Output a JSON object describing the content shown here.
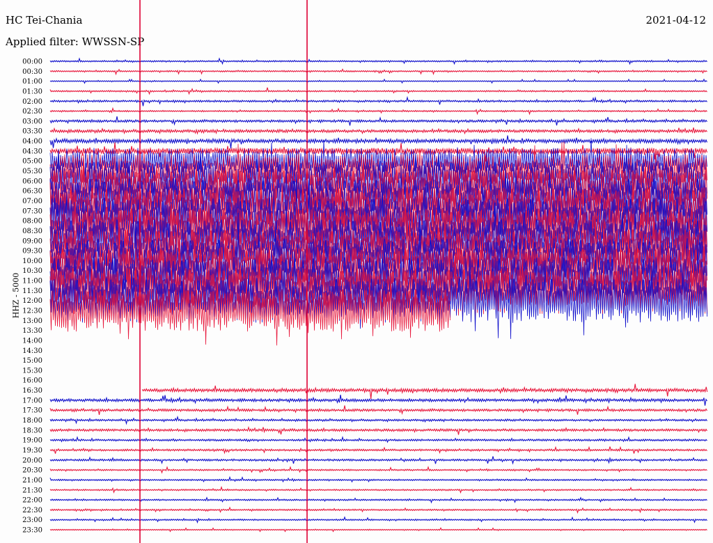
{
  "header": {
    "station": "HC Tei-Chania",
    "date": "2021-04-12",
    "filter": "Applied filter: WWSSN-SP"
  },
  "colors": {
    "trace_a": "#1010cc",
    "trace_b": "#e8183c",
    "marker": "#dd0033",
    "background": "#fdfdfd"
  },
  "chart_data": {
    "type": "line",
    "title": "HC Tei-Chania",
    "ylabel": "HHZ - 5000",
    "xlabel": "",
    "grid": false,
    "tick_labels": [
      "00:00",
      "00:30",
      "01:00",
      "01:30",
      "02:00",
      "02:30",
      "03:00",
      "03:30",
      "04:00",
      "04:30",
      "05:00",
      "05:30",
      "06:00",
      "06:30",
      "07:00",
      "07:30",
      "08:00",
      "08:30",
      "09:00",
      "09:30",
      "10:00",
      "10:30",
      "11:00",
      "11:30",
      "12:00",
      "12:30",
      "13:00",
      "13:30",
      "14:00",
      "14:30",
      "15:00",
      "15:30",
      "16:00",
      "16:30",
      "17:00",
      "17:30",
      "18:00",
      "18:30",
      "19:00",
      "19:30",
      "20:00",
      "20:30",
      "21:00",
      "21:30",
      "22:00",
      "22:30",
      "23:00",
      "23:30"
    ],
    "row_noise_levels": [
      0.03,
      0.03,
      0.02,
      0.03,
      0.04,
      0.03,
      0.05,
      0.06,
      0.08,
      0.12,
      0.55,
      0.7,
      0.85,
      0.9,
      0.95,
      1.0,
      1.0,
      0.95,
      0.9,
      0.9,
      0.95,
      1.0,
      1.0,
      1.0,
      0.95,
      0.9,
      0,
      0,
      0,
      0,
      0,
      0,
      0,
      0.07,
      0.06,
      0.05,
      0.04,
      0.05,
      0.04,
      0.04,
      0.04,
      0.03,
      0.03,
      0.03,
      0.03,
      0.03,
      0.03,
      0.02
    ],
    "row_start_fraction": [
      0,
      0,
      0,
      0,
      0,
      0,
      0,
      0,
      0,
      0,
      0,
      0,
      0,
      0,
      0,
      0,
      0,
      0,
      0,
      0,
      0,
      0,
      0,
      0,
      0,
      0,
      0,
      0,
      0,
      0,
      0,
      0,
      0,
      0.14,
      0,
      0,
      0,
      0,
      0,
      0,
      0,
      0,
      0,
      0,
      0,
      0,
      0,
      0
    ],
    "row_end_fraction": [
      1,
      1,
      1,
      1,
      1,
      1,
      1,
      1,
      1,
      1,
      1,
      1,
      1,
      1,
      1,
      1,
      1,
      1,
      1,
      1,
      1,
      1,
      1,
      1,
      1,
      0.61,
      0,
      0,
      0,
      0,
      0,
      0,
      0,
      1,
      1,
      1,
      1,
      1,
      1,
      1,
      1,
      1,
      1,
      1,
      1,
      1,
      1,
      1
    ],
    "gap": {
      "start": "13:00",
      "end": "16:30"
    },
    "event_markers": [
      {
        "label": "marker-1"
      },
      {
        "label": "marker-2"
      }
    ]
  }
}
